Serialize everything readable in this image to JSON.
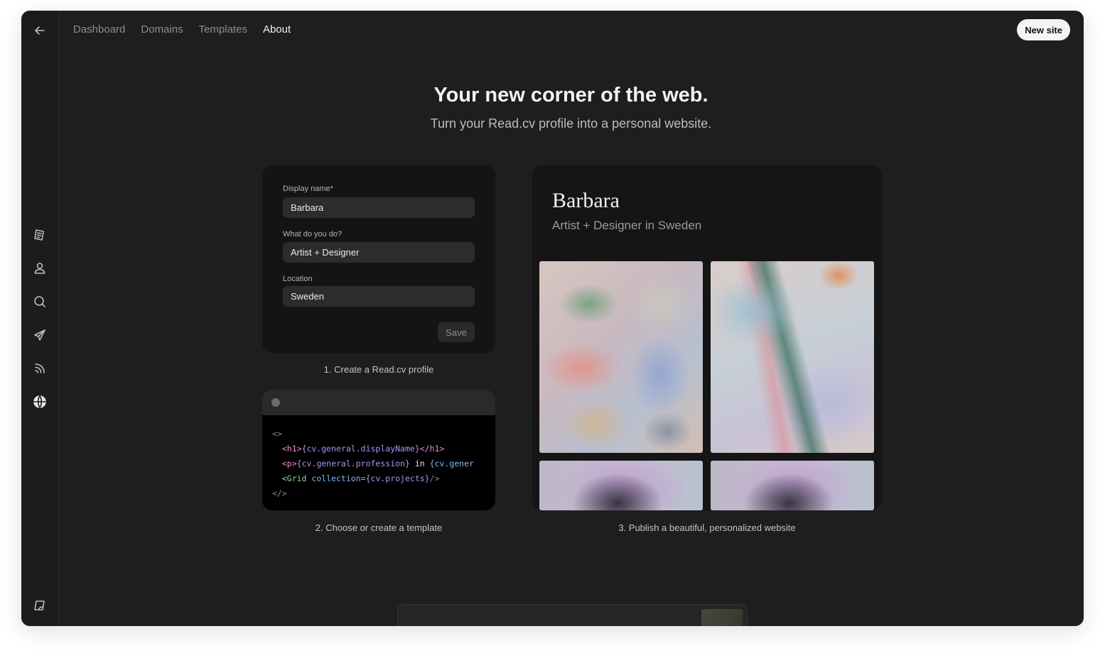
{
  "nav": {
    "back_icon": "arrow-left-icon",
    "links": [
      "Dashboard",
      "Domains",
      "Templates",
      "About"
    ],
    "active": "About",
    "new_site_label": "New site"
  },
  "sidebar": {
    "icons": [
      "document-icon",
      "profile-icon",
      "search-icon",
      "send-icon",
      "feed-icon",
      "globe-icon",
      "note-icon"
    ]
  },
  "hero": {
    "title": "Your new corner of the web.",
    "subtitle": "Turn your Read.cv profile into a personal website."
  },
  "form": {
    "display_name_label": "Display name*",
    "display_name_value": "Barbara",
    "profession_label": "What do you do?",
    "profession_value": "Artist + Designer",
    "location_label": "Location",
    "location_value": "Sweden",
    "save_label": "Save"
  },
  "steps": {
    "step1": "1. Create a Read.cv profile",
    "step2": "2. Choose or create a template",
    "step3": "3. Publish a beautiful, personalized website"
  },
  "code": {
    "open": "<>",
    "close": "</>",
    "line1_open": "<h1>",
    "line1_expr": "{cv.general.displayName}",
    "line1_close": "</h1>",
    "line2_open": "<p>",
    "line2_expr": "{cv.general.profession}",
    "line2_text": " in ",
    "line2_expr2": "{cv.gener",
    "line3_comp": "<Grid ",
    "line3_attr": "collection=",
    "line3_expr": "{cv.projects}",
    "line3_end": "/>"
  },
  "preview": {
    "name": "Barbara",
    "subtitle": "Artist + Designer in Sweden"
  }
}
